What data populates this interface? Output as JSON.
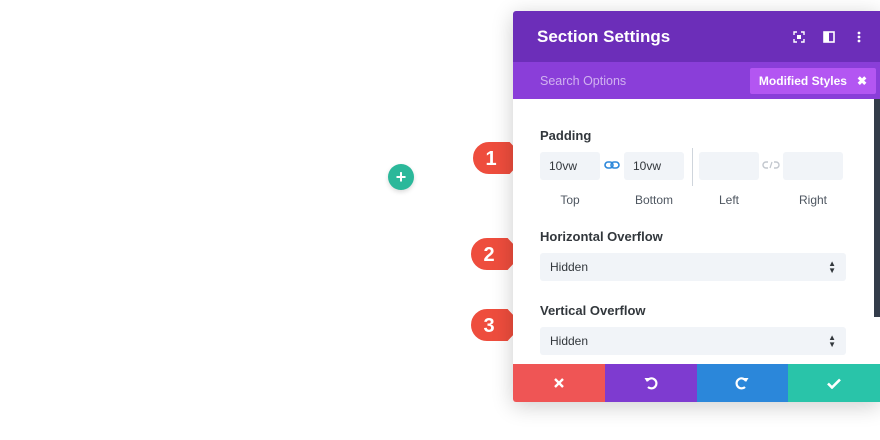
{
  "modal": {
    "title": "Section Settings",
    "search_placeholder": "Search Options",
    "modified_styles_label": "Modified Styles",
    "modified_styles_close": "✖"
  },
  "padding": {
    "label": "Padding",
    "top_value": "10vw",
    "bottom_value": "10vw",
    "left_value": "",
    "right_value": "",
    "top_label": "Top",
    "bottom_label": "Bottom",
    "left_label": "Left",
    "right_label": "Right"
  },
  "horizontal_overflow": {
    "label": "Horizontal Overflow",
    "value": "Hidden"
  },
  "vertical_overflow": {
    "label": "Vertical Overflow",
    "value": "Hidden"
  },
  "callouts": {
    "one": "1",
    "two": "2",
    "three": "3"
  },
  "add_button": "+",
  "colors": {
    "header": "#6c2eb9",
    "searchbar": "#8a3ed9",
    "modified_badge": "#b356f2",
    "cancel": "#ef5555",
    "undo": "#7e3bd0",
    "redo": "#2b87da",
    "save": "#29c4a9",
    "callout": "#ee4d3d",
    "add_button": "#2bb89a"
  },
  "icons": {
    "header": [
      "focus-icon",
      "split-view-icon",
      "more-vertical-icon"
    ],
    "footer": [
      "close-icon",
      "undo-icon",
      "redo-icon",
      "checkmark-icon"
    ]
  }
}
